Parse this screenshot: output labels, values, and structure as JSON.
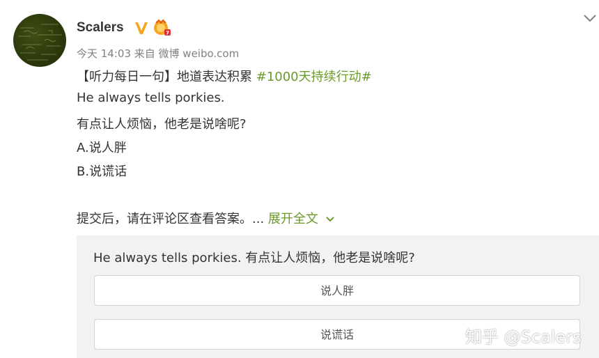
{
  "post": {
    "author": "Scalers",
    "meta": "今天 14:03 来自 微博 weibo.com",
    "line1_prefix": "【听力每日一句】地道表达积累 ",
    "line1_topic": "#1000天持续行动#",
    "line2": "He always tells porkies.",
    "line3": "有点让人烦恼，他老是说啥呢?",
    "line4": "A.说人胖",
    "line5": "B.说谎话",
    "line6": "提交后，请在评论区查看答案。... ",
    "expand_label": "展开全文"
  },
  "vote": {
    "question": "He always tells porkies. 有点让人烦恼，他老是说啥呢?",
    "options": [
      "说人胖",
      "说谎话"
    ]
  },
  "watermark": "知乎 @Scalers",
  "colors": {
    "accent_green": "#6b9a2b",
    "vip_gold": "#f5a623",
    "card_bg": "#f2f2f2"
  },
  "icons": {
    "vbadge": "verified-v-icon",
    "medal": "medal-icon",
    "menu": "chevron-down-icon",
    "expand": "chevron-down-icon"
  }
}
